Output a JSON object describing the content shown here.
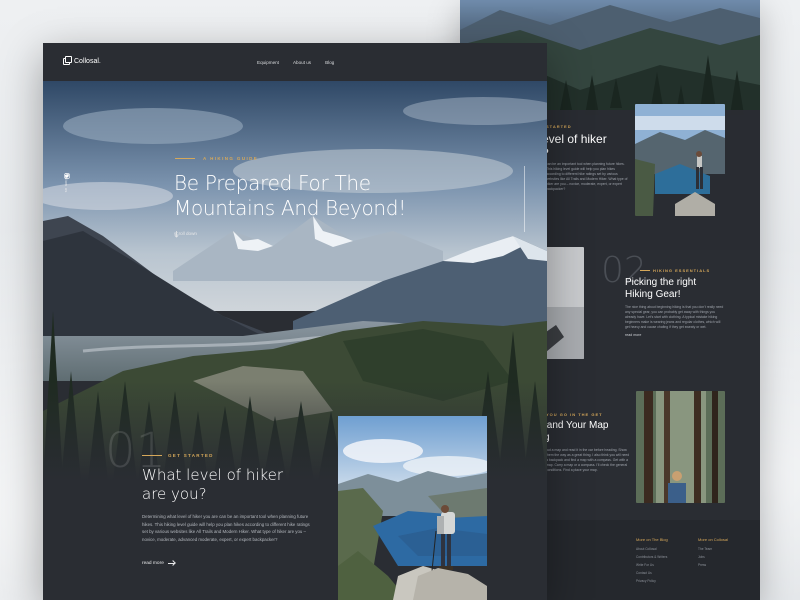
{
  "brand": {
    "name": "Collosal."
  },
  "nav": {
    "items": [
      "Equipment",
      "About us",
      "Blog"
    ]
  },
  "hero": {
    "eyebrow": "A HIKING GUIDE",
    "title_line1": "Be Prepared For The",
    "title_line2": "Mountains And Beyond!",
    "scroll_label": "scroll down"
  },
  "social": {
    "label": "Follow us",
    "icons": [
      "instagram-icon",
      "twitter-icon"
    ]
  },
  "section1": {
    "number": "01",
    "eyebrow": "GET STARTED",
    "title_line1": "What level of  hiker",
    "title_line2": "are you?",
    "body": "Determining what level of hiker you are can be an important tool when planning future hikes. This hiking level guide will help you plan hikes according to different hike ratings set by various websites like All Trails and Modern Hiker. What type of hiker are you – novice, moderate, advanced moderate, expert, or expert backpacker?",
    "link": "read more"
  },
  "back_page": {
    "sec1_eyebrow": "STARTED",
    "sec1_title_line1": "evel of  hiker",
    "sec1_title_line2": "?",
    "sec1_body": "can be an important tool when planning future hikes. This hiking level guide will help you plan hikes according to different hike ratings set by various websites like All Trails and Modern Hiker. What type of hiker are you – novice, moderate, expert, or expert backpacker?",
    "sec2_number": "02",
    "sec2_eyebrow": "HIKING ESSENTIALS",
    "sec2_title_line1": "Picking the right",
    "sec2_title_line2": "Hiking Gear!",
    "sec2_body": "The nice thing about beginning hiking is that you don't really need any special gear, you can probably get away with things you already have. Let's start with clothing. A typical mistake hiking beginners make is wearing jeans and regular clothes, which will get heavy and cause chafing if they get sweaty or wet.",
    "sec2_link": "read more",
    "sec3_eyebrow": "YOU GO IN THE GET",
    "sec3_title_line1": "tand Your Map",
    "sec3_title_line2": "g",
    "sec3_body": "out a map and read it in the car before heading. Show them the way as a great thing. I also think you will need a backpack and find a map with a compass. Get with a map. Carry a map or a compass. I'll check the general conditions. Find a place your map.",
    "footer_col1_title": "More on The Blog",
    "footer_col1_items": [
      "About Collosal",
      "Contributors & Writers",
      "Write For Us",
      "Contact Us",
      "Privacy Policy"
    ],
    "footer_col2_title": "More on Collosal",
    "footer_col2_items": [
      "The Team",
      "Jobs",
      "Press"
    ]
  },
  "colors": {
    "accent": "#d6a85a",
    "page_bg": "#2a2d33"
  }
}
